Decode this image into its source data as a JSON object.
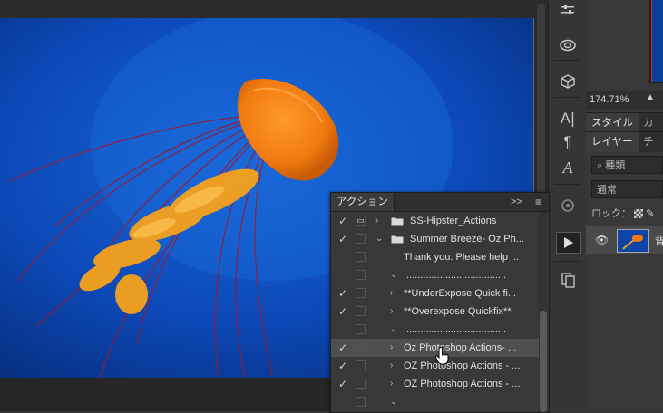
{
  "app": {
    "zoom": "174.71%"
  },
  "right_panel": {
    "tabs_top": [
      "スタイル",
      "カラ"
    ],
    "tabs_layers": [
      "レイヤー",
      "チャ"
    ],
    "search_placeholder": "種類",
    "blend_mode": "通常",
    "lock_label": "ロック：",
    "layer_name": "背"
  },
  "actions_panel": {
    "title": "アクション",
    "expand_glyph": ">>",
    "menu_glyph": "≡",
    "rows": [
      {
        "checked": true,
        "dialog": "▭",
        "twirl": "›",
        "folder": true,
        "label": "SS-Hipster_Actions"
      },
      {
        "checked": true,
        "dialog": "",
        "twirl": "⌄",
        "folder": true,
        "label": "Summer Breeze- Oz Ph..."
      },
      {
        "checked": false,
        "dialog": "",
        "twirl": "",
        "folder": false,
        "label": "Thank you. Please help ..."
      },
      {
        "checked": false,
        "dialog": "",
        "twirl": "⌄",
        "folder": false,
        "label": "....................................."
      },
      {
        "checked": true,
        "dialog": "",
        "twirl": "›",
        "folder": false,
        "label": "**UnderExpose Quick fi..."
      },
      {
        "checked": true,
        "dialog": "",
        "twirl": "›",
        "folder": false,
        "label": "**Overexpose Quickfix**"
      },
      {
        "checked": false,
        "dialog": "",
        "twirl": "⌄",
        "folder": false,
        "label": "....................................."
      },
      {
        "checked": true,
        "dialog": "",
        "twirl": "›",
        "folder": false,
        "label": "Oz Photoshop Actions- ..."
      },
      {
        "checked": true,
        "dialog": "",
        "twirl": "›",
        "folder": false,
        "label": "OZ Photoshop Actions - ..."
      },
      {
        "checked": true,
        "dialog": "",
        "twirl": "›",
        "folder": false,
        "label": "OZ Photoshop Actions - ..."
      },
      {
        "checked": false,
        "dialog": "",
        "twirl": "⌄",
        "folder": false,
        "label": ""
      }
    ],
    "selected_index": 7
  },
  "icons": {
    "strip": [
      "adjust-sliders-icon",
      "creative-cloud-libraries-icon",
      "3d-cube-icon",
      "character-icon",
      "paragraph-icon",
      "glyphs-icon",
      "brush-settings-icon",
      "actions-play-icon",
      "history-icon"
    ],
    "check": "✓"
  },
  "colors": {
    "accent_select": "#4f4f4f",
    "panel_bg": "#383838",
    "canvas_blue": "#0a3e9a",
    "jelly_orange": "#f07a10"
  }
}
